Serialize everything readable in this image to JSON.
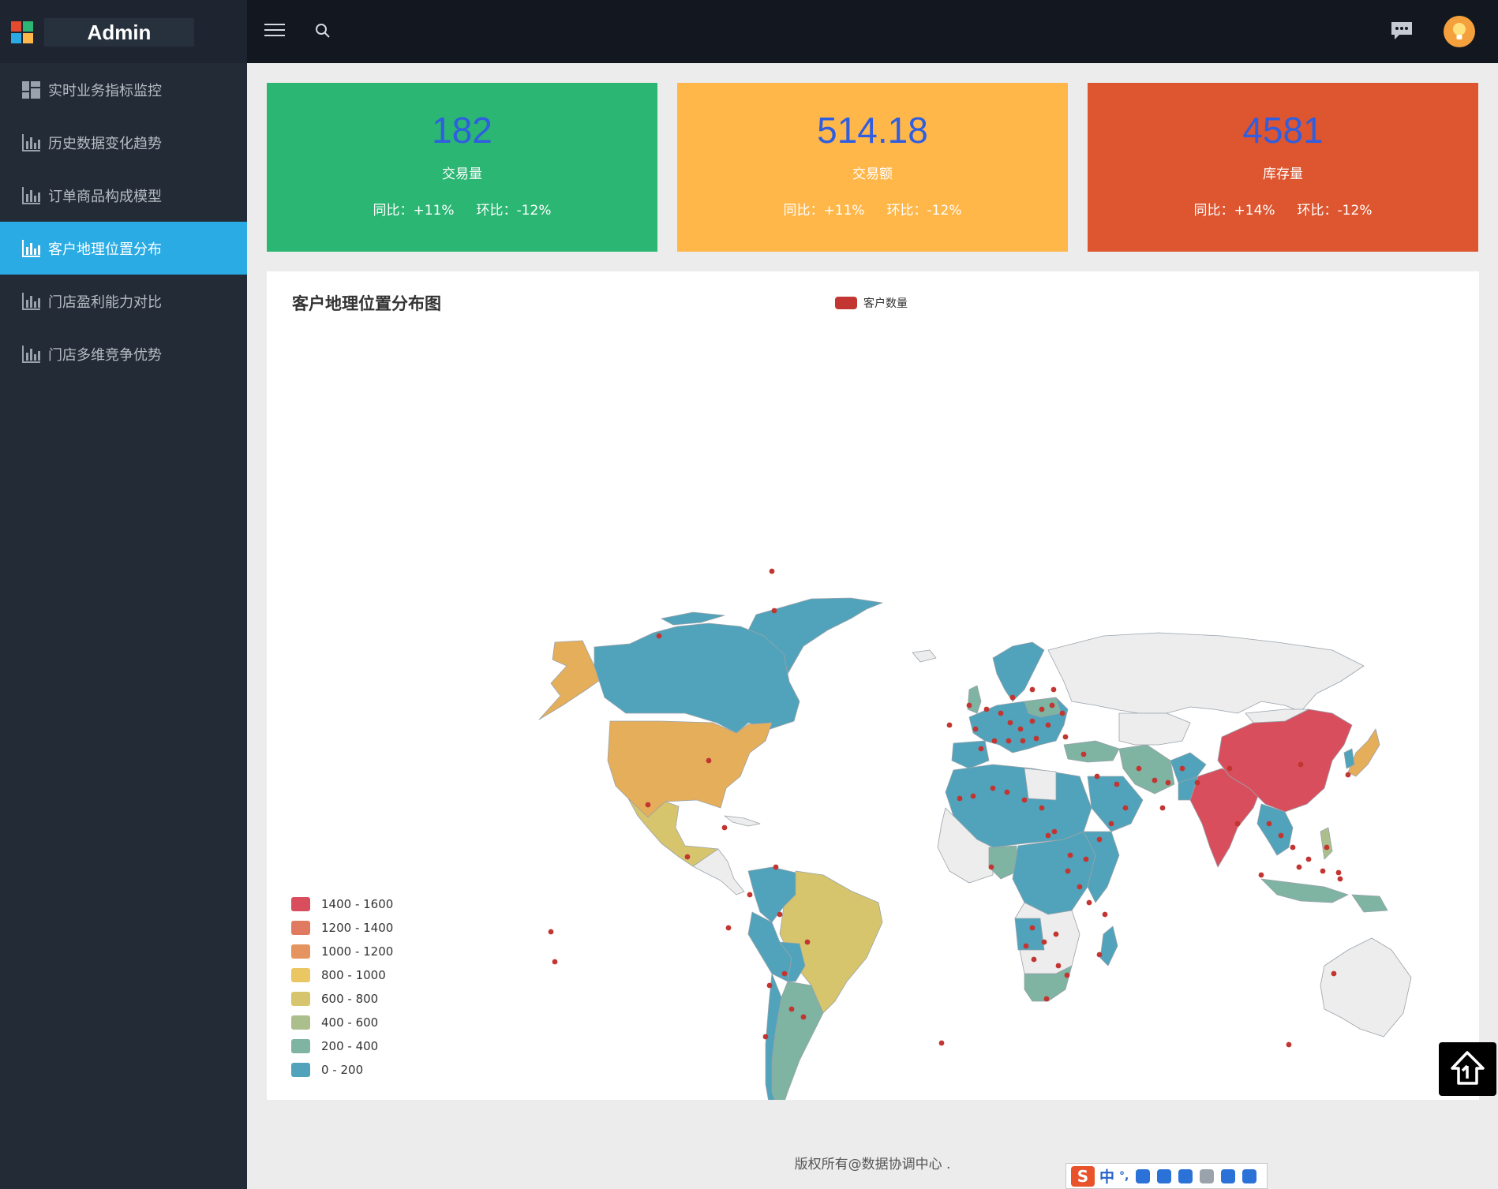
{
  "app": {
    "title": "Admin"
  },
  "sidebar": {
    "items": [
      {
        "label": "实时业务指标监控",
        "icon": "dashboard-icon",
        "active": false
      },
      {
        "label": "历史数据变化趋势",
        "icon": "bar-chart-icon",
        "active": false
      },
      {
        "label": "订单商品构成模型",
        "icon": "bar-chart-icon",
        "active": false
      },
      {
        "label": "客户地理位置分布",
        "icon": "bar-chart-icon",
        "active": true
      },
      {
        "label": "门店盈利能力对比",
        "icon": "bar-chart-icon",
        "active": false
      },
      {
        "label": "门店多维竞争优势",
        "icon": "bar-chart-icon",
        "active": false
      }
    ]
  },
  "topbar": {
    "menu_icon": "hamburger-menu-icon",
    "search_icon": "search-icon",
    "chat_icon": "chat-bubble-icon",
    "avatar_icon": "lightbulb-avatar-icon"
  },
  "stats": [
    {
      "value": "182",
      "label": "交易量",
      "yoy": "同比：+11%",
      "mom": "环比：-12%",
      "color": "#2bb673"
    },
    {
      "value": "514.18",
      "label": "交易额",
      "yoy": "同比：+11%",
      "mom": "环比：-12%",
      "color": "#ffb74a"
    },
    {
      "value": "4581",
      "label": "库存量",
      "yoy": "同比：+14%",
      "mom": "环比：-12%",
      "color": "#dd5630"
    }
  ],
  "map": {
    "title": "客户地理位置分布图",
    "legend": "客户数量",
    "legend_color": "#c23531",
    "ranges": [
      {
        "label": "1400 - 1600",
        "color": "#d94e5d"
      },
      {
        "label": "1200 - 1400",
        "color": "#e07b62"
      },
      {
        "label": "1000 - 1200",
        "color": "#e5945f"
      },
      {
        "label": "800 - 1000",
        "color": "#eac763"
      },
      {
        "label": "600 - 800",
        "color": "#d6c56c"
      },
      {
        "label": "400 - 600",
        "color": "#aabf8c"
      },
      {
        "label": "200 - 400",
        "color": "#7fb3a2"
      },
      {
        "label": "0 - 200",
        "color": "#50a3ba"
      }
    ]
  },
  "back_to_top_icon": "back-to-top-icon",
  "footer": {
    "text": "版权所有@数据协调中心 ."
  },
  "ime": {
    "logo": "S",
    "mode": "中",
    "punct": "°,"
  }
}
